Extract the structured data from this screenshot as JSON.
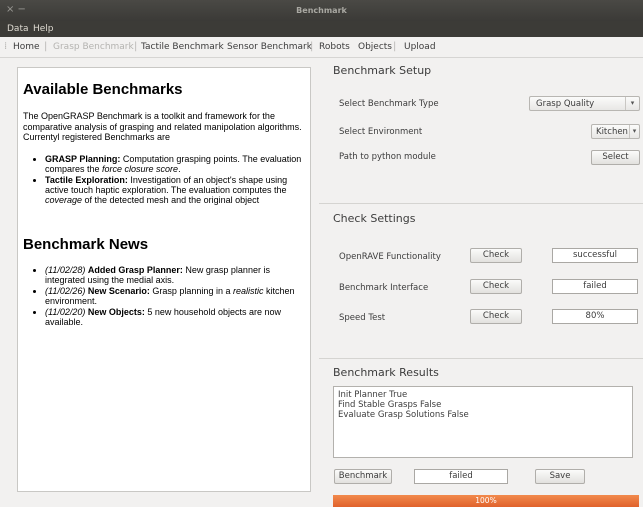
{
  "window": {
    "title": "Benchmark",
    "controls": "× −"
  },
  "menu": [
    "Data",
    "Help"
  ],
  "toolbar": [
    {
      "label": "Home",
      "disabled": false
    },
    {
      "label": "Grasp Benchmark",
      "disabled": true
    },
    {
      "label": "Tactile Benchmark",
      "disabled": false
    },
    {
      "label": "Sensor Benchmark",
      "disabled": false
    },
    {
      "label": "Robots",
      "disabled": false
    },
    {
      "label": "Objects",
      "disabled": false
    },
    {
      "label": "Upload",
      "disabled": false
    }
  ],
  "info": {
    "heading1": "Available Benchmarks",
    "intro": "The OpenGRASP Benchmark is a toolkit and framework for the comparative analysis of grasping and related manipolation algorithms. Currentyl registered Benchmarks are",
    "benchmarks": [
      {
        "name": "GRASP Planning:",
        "text1": " Computation grasping points. The evaluation compares the ",
        "em": "force closure score",
        "text2": "."
      },
      {
        "name": "Tactile Exploration:",
        "text1": " Investigation of an object's shape using active touch haptic exploration. The evaluation computes the ",
        "em": "coverage",
        "text2": " of the detected mesh and the original object"
      }
    ],
    "heading2": "Benchmark News",
    "news": [
      {
        "date": "(11/02/28)",
        "title": "Added Grasp Planner:",
        "text1": " New grasp planner is integrated using the medial axis.",
        "em": "",
        "text2": ""
      },
      {
        "date": "(11/02/26)",
        "title": "New Scenario:",
        "text1": " Grasp planning in a ",
        "em": "realistic",
        "text2": " kitchen environment."
      },
      {
        "date": "(11/02/20)",
        "title": "New Objects:",
        "text1": " 5 new household objects are now available.",
        "em": "",
        "text2": ""
      }
    ]
  },
  "setup": {
    "title": "Benchmark Setup",
    "type_label": "Select Benchmark Type",
    "type_value": "Grasp Quality",
    "env_label": "Select Environment",
    "env_value": "Kitchen",
    "python_label": "Path to python module",
    "select_button": "Select"
  },
  "check": {
    "title": "Check Settings",
    "rows": [
      {
        "label": "OpenRAVE Functionality",
        "button": "Check",
        "result": "successful"
      },
      {
        "label": "Benchmark Interface",
        "button": "Check",
        "result": "failed"
      },
      {
        "label": "Speed Test",
        "button": "Check",
        "result": "80%"
      }
    ]
  },
  "results": {
    "title": "Benchmark Results",
    "lines": [
      "Init Planner True",
      "Find Stable Grasps False",
      "Evaluate Grasp Solutions False"
    ],
    "benchmark_button": "Benchmark",
    "status": "failed",
    "save_button": "Save",
    "progress_label": "100%",
    "progress": 1.0,
    "progress_color": "#e8713a"
  }
}
